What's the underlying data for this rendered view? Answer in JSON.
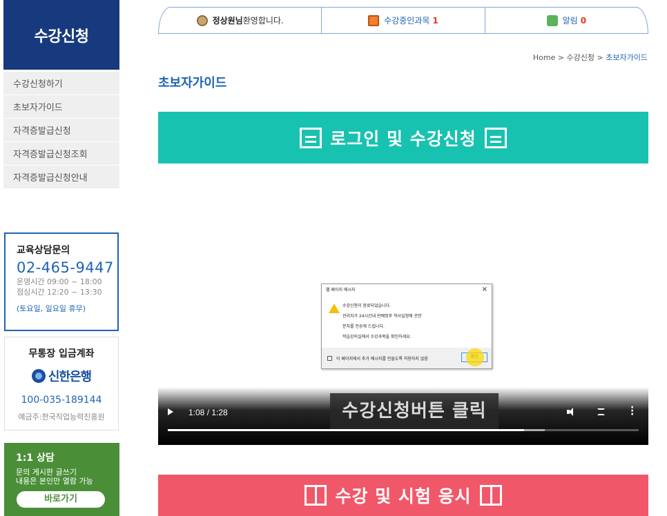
{
  "sidebar": {
    "title": "수강신청",
    "items": [
      {
        "label": "수강신청하기"
      },
      {
        "label": "초보자가이드"
      },
      {
        "label": "자격증발급신청"
      },
      {
        "label": "자격증발급신청조회"
      },
      {
        "label": "자격증발급신청안내"
      }
    ],
    "consult": {
      "title": "교육상담문의",
      "phone": "02-465-9447",
      "hours1": "운영시간 09:00 ~ 18:00",
      "hours2": "점심시간 12:20 ~ 13:30",
      "closed": "(토요일, 일요일 휴무)"
    },
    "bank": {
      "title": "무통장 입금계좌",
      "bank_name": "신한은행",
      "account": "100-035-189144",
      "holder": "예금주:한국직업능력진흥원"
    },
    "qa": {
      "title": "1:1 상담",
      "desc1": "문의 게시판 글쓰기",
      "desc2": "내용은 본인만 열람 가능",
      "button": "바로가기"
    }
  },
  "top_tabs": {
    "user": {
      "name": "정상원님",
      "greeting": "환영합니다.",
      "icon": "user-icon"
    },
    "courses": {
      "label": "수강중인과목",
      "count": "1",
      "icon": "course-icon"
    },
    "alarm": {
      "label": "알림",
      "count": "0",
      "icon": "alarm-icon"
    }
  },
  "breadcrumb": {
    "home": "Home",
    "sep": ">",
    "section": "수강신청",
    "current": "초보자가이드"
  },
  "page_title": "초보자가이드",
  "banners": {
    "login": "로그인 및 수강신청",
    "exam": "수강 및 시험 응시"
  },
  "video": {
    "time": "1:08 / 1:28",
    "played_fraction": 0.756,
    "buffered_fraction": 0.8,
    "caption": "수강신청버튼 클릭",
    "dialog": {
      "title": "웹 페이지 메시지",
      "close": "×",
      "line1": "수강신청이 완료되었습니다.",
      "line2": "관리자가 24시간내 반배정후 학사일정에 관한",
      "line3": "문자를 전송해 드립니다.",
      "line4": "학습강의실에서 수강과목을 확인하세요.",
      "checkbox": "이 페이지에서 추가 메시지를 만들도록 허용하지 않음",
      "ok": "확인"
    }
  },
  "colors": {
    "sidebar_title_bg": "#173a7e",
    "accent_blue": "#1e63b3",
    "teal_banner": "#18c2b0",
    "pink_banner": "#f0586a",
    "qa_green": "#4a8f38"
  }
}
